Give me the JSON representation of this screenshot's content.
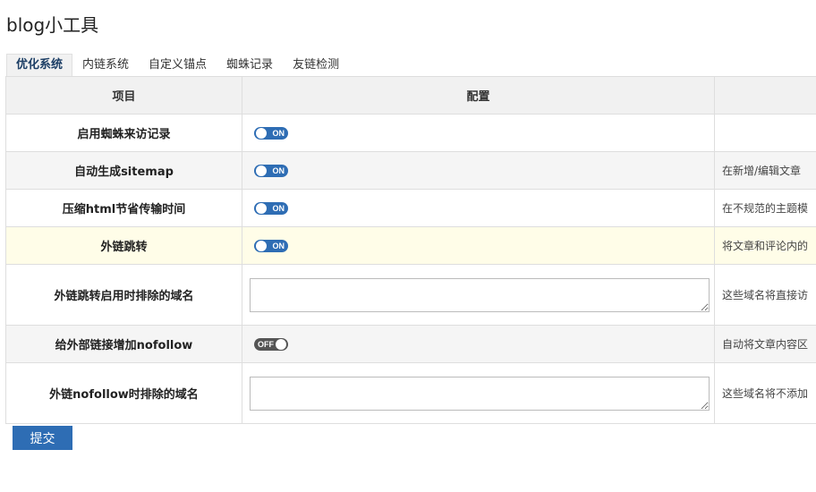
{
  "page_title": "blog小工具",
  "tabs": [
    {
      "label": "优化系统",
      "active": true
    },
    {
      "label": "内链系统",
      "active": false
    },
    {
      "label": "自定义锚点",
      "active": false
    },
    {
      "label": "蜘蛛记录",
      "active": false
    },
    {
      "label": "友链检测",
      "active": false
    }
  ],
  "table": {
    "headers": {
      "item": "项目",
      "config": "配置",
      "desc": ""
    },
    "rows": [
      {
        "name": "启用蜘蛛来访记录",
        "type": "toggle",
        "state": "ON",
        "desc": ""
      },
      {
        "name": "自动生成sitemap",
        "type": "toggle",
        "state": "ON",
        "desc": "在新增/编辑文章"
      },
      {
        "name": "压缩html节省传输时间",
        "type": "toggle",
        "state": "ON",
        "desc": "在不规范的主题模"
      },
      {
        "name": "外链跳转",
        "type": "toggle",
        "state": "ON",
        "desc": "将文章和评论内的"
      },
      {
        "name": "外链跳转启用时排除的域名",
        "type": "textarea",
        "value": "",
        "desc": "这些域名将直接访"
      },
      {
        "name": "给外部链接增加nofollow",
        "type": "toggle",
        "state": "OFF",
        "desc": "自动将文章内容区"
      },
      {
        "name": "外链nofollow时排除的域名",
        "type": "textarea",
        "value": "",
        "desc": "这些域名将不添加"
      }
    ]
  },
  "submit_label": "提交",
  "colors": {
    "accent": "#2e6db4",
    "toggle_off": "#555555",
    "highlight_row": "#fffde8"
  }
}
